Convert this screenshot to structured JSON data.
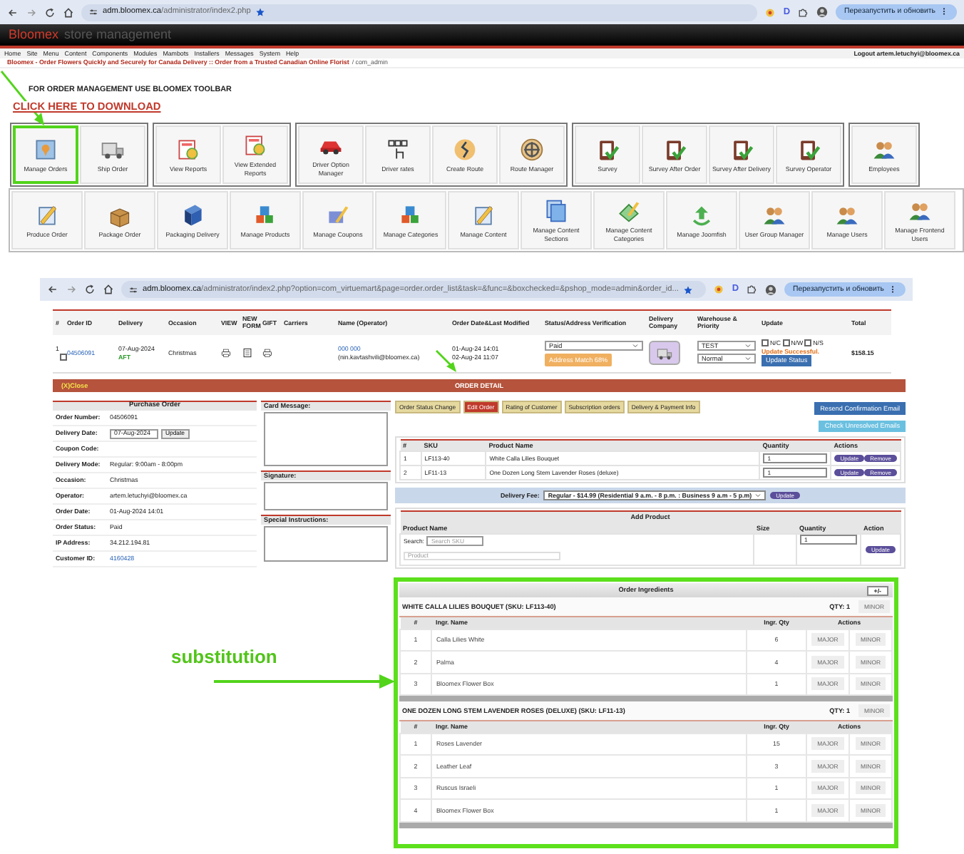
{
  "browsers": [
    {
      "host": "adm.bloomex.ca",
      "path": "/administrator/index2.php",
      "extension_letter": "D",
      "restart_button": "Перезапустить и обновить"
    },
    {
      "host": "adm.bloomex.ca",
      "path": "/administrator/index2.php?option=com_virtuemart&page=order.order_list&task=&func=&boxchecked=&pshop_mode=admin&order_id...",
      "extension_letter": "D",
      "restart_button": "Перезапустить и обновить"
    }
  ],
  "header": {
    "logo": "Bloomex",
    "subtitle": "store management"
  },
  "menu": [
    "Home",
    "Site",
    "Menu",
    "Content",
    "Components",
    "Modules",
    "Mambots",
    "Installers",
    "Messages",
    "System",
    "Help"
  ],
  "logout": "Logout artem.letuchyi@bloomex.ca",
  "breadcrumb": {
    "link": "Bloomex - Order Flowers Quickly and Securely for Canada Delivery :: Order from a Trusted Canadian Online Florist",
    "current": "/ com_admin"
  },
  "toolbar_notice": "FOR ORDER MANAGEMENT USE  BLOOMEX TOOLBAR",
  "download_link": "CLICK HERE TO DOWNLOAD",
  "toolbar_rows": [
    {
      "groups": [
        [
          {
            "label": "Manage Orders",
            "selected": true
          },
          {
            "label": "Ship Order",
            "selected": false
          }
        ],
        [
          {
            "label": "View Reports",
            "selected": false
          },
          {
            "label": "View Extended Reports",
            "selected": false
          }
        ],
        [
          {
            "label": "Driver Option Manager",
            "selected": false
          },
          {
            "label": "Driver rates",
            "selected": false
          },
          {
            "label": "Create Route",
            "selected": false
          },
          {
            "label": "Route Manager",
            "selected": false
          }
        ],
        [
          {
            "label": "Survey",
            "selected": false
          },
          {
            "label": "Survey After Order",
            "selected": false
          },
          {
            "label": "Survey After Delivery",
            "selected": false
          },
          {
            "label": "Survey Operator",
            "selected": false
          }
        ],
        [
          {
            "label": "Employees",
            "selected": false
          }
        ]
      ]
    },
    {
      "groups": [
        [
          {
            "label": "Produce Order",
            "selected": false
          },
          {
            "label": "Package Order",
            "selected": false
          },
          {
            "label": "Packaging Delivery",
            "selected": false
          },
          {
            "label": "Manage Products",
            "selected": false
          },
          {
            "label": "Manage Coupons",
            "selected": false
          },
          {
            "label": "Manage Categories",
            "selected": false
          },
          {
            "label": "Manage Content",
            "selected": false
          },
          {
            "label": "Manage Content Sections",
            "selected": false
          },
          {
            "label": "Manage Content Categories",
            "selected": false
          },
          {
            "label": "Manage Joomfish",
            "selected": false
          },
          {
            "label": "User Group Manager",
            "selected": false
          },
          {
            "label": "Manage Users",
            "selected": false
          },
          {
            "label": "Manage Frontend Users",
            "selected": false
          }
        ]
      ]
    }
  ],
  "order_table": {
    "columns": [
      "#",
      "Order ID",
      "Delivery",
      "Occasion",
      "VIEW",
      "NEW FORM",
      "GIFT",
      "Carriers",
      "Name (Operator)",
      "Order Date&Last Modified",
      "Status/Address Verification",
      "Delivery Company",
      "Warehouse & Priority",
      "Update",
      "Total"
    ],
    "rows": [
      {
        "number": "1",
        "checked": false,
        "order_id": "04506091",
        "delivery_date": "07-Aug-2024",
        "delivery_slot": "AFT",
        "occasion": "Christmas",
        "name": "000 000",
        "email": "(nin.kavtashvili@bloomex.ca)",
        "order_date": "01-Aug-24 14:01",
        "modified": "02-Aug-24 11:07",
        "status": "Paid",
        "address_match": "Address Match 68%",
        "warehouse": "TEST",
        "priority": "Normal",
        "flags": [
          {
            "label": "N/C",
            "checked": false
          },
          {
            "label": "N/W",
            "checked": false
          },
          {
            "label": "N/S",
            "checked": false
          }
        ],
        "update_message": "Update Successful.",
        "update_button": "Update Status",
        "total": "$158.15"
      }
    ]
  },
  "order_detail": {
    "close": "(X)Close",
    "title": "ORDER DETAIL"
  },
  "purchase_order": {
    "title": "Purchase Order",
    "fields": [
      {
        "label": "Order Number:",
        "value": "04506091",
        "kind": "text"
      },
      {
        "label": "Delivery Date:",
        "value": "07-Aug-2024",
        "button": "Update",
        "kind": "input"
      },
      {
        "label": "Coupon Code:",
        "kind": "text"
      },
      {
        "label": "Delivery Mode:",
        "value": "Regular: 9:00am - 8:00pm",
        "kind": "text"
      },
      {
        "label": "Occasion:",
        "value": "Christmas",
        "kind": "text"
      },
      {
        "label": "Operator:",
        "value": "artem.letuchyi@bloomex.ca",
        "kind": "text"
      },
      {
        "label": "Order Date:",
        "value": "01-Aug-2024 14:01",
        "kind": "text"
      },
      {
        "label": "Order Status:",
        "value": "Paid",
        "kind": "text"
      },
      {
        "label": "IP Address:",
        "value": "34.212.194.81",
        "kind": "text"
      },
      {
        "label": "Customer ID:",
        "value": "4160428",
        "kind": "link"
      }
    ]
  },
  "notes": [
    {
      "title": "Card Message:"
    },
    {
      "title": "Signature:"
    },
    {
      "title": "Special Instructions:"
    }
  ],
  "detail_tabs": [
    {
      "label": "Order Status Change",
      "selected": false
    },
    {
      "label": "Edit Order",
      "selected": true
    },
    {
      "label": "Rating of Customer",
      "selected": false
    },
    {
      "label": "Subscription orders",
      "selected": false
    },
    {
      "label": "Delivery & Payment Info",
      "selected": false
    }
  ],
  "email_buttons": [
    "Resend Confirmation Email",
    "Check Unresolved Emails"
  ],
  "products": {
    "columns": [
      "#",
      "SKU",
      "Product Name",
      "Quantity",
      "Actions"
    ],
    "rows": [
      {
        "number": "1",
        "sku": "LF113-40",
        "name": "White Calla Lilies Bouquet",
        "quantity": "1",
        "actions": [
          "Update",
          "Remove"
        ]
      },
      {
        "number": "2",
        "sku": "LF11-13",
        "name": "One Dozen Long Stem Lavender Roses (deluxe)",
        "quantity": "1",
        "actions": [
          "Update",
          "Remove"
        ]
      }
    ]
  },
  "delivery_fee": {
    "label": "Delivery Fee:",
    "value": "Regular - $14.99 (Residential 9 a.m. - 8 p.m. : Business 9 a.m - 5 p.m)",
    "button": "Update"
  },
  "add_product": {
    "title": "Add Product",
    "columns": [
      "Product Name",
      "Size",
      "Quantity",
      "Action"
    ],
    "search_label": "Search:",
    "search_placeholder": "Search SKU",
    "product_placeholder": "Product",
    "quantity": "1",
    "button": "Update"
  },
  "annotation": "substitution",
  "ingredients": {
    "title": "Order Ingredients",
    "toggle": "+/-",
    "products": [
      {
        "title": "WHITE CALLA LILIES BOUQUET (SKU: LF113-40)",
        "qty": "QTY: 1",
        "button": "MINOR",
        "columns": [
          "#",
          "Ingr. Name",
          "Ingr. Qty",
          "Actions"
        ],
        "rows": [
          {
            "number": "1",
            "name": "Calla Lilies White",
            "qty": "6",
            "actions": [
              "MAJOR",
              "MINOR"
            ]
          },
          {
            "number": "2",
            "name": "Palma",
            "qty": "4",
            "actions": [
              "MAJOR",
              "MINOR"
            ]
          },
          {
            "number": "3",
            "name": "Bloomex Flower Box",
            "qty": "1",
            "actions": [
              "MAJOR",
              "MINOR"
            ]
          }
        ]
      },
      {
        "title": "ONE DOZEN LONG STEM LAVENDER ROSES (DELUXE) (SKU: LF11-13)",
        "qty": "QTY: 1",
        "button": "MINOR",
        "columns": [
          "#",
          "Ingr. Name",
          "Ingr. Qty",
          "Actions"
        ],
        "rows": [
          {
            "number": "1",
            "name": "Roses Lavender",
            "qty": "15",
            "actions": [
              "MAJOR",
              "MINOR"
            ]
          },
          {
            "number": "2",
            "name": "Leather Leaf",
            "qty": "3",
            "actions": [
              "MAJOR",
              "MINOR"
            ]
          },
          {
            "number": "3",
            "name": "Ruscus Israeli",
            "qty": "1",
            "actions": [
              "MAJOR",
              "MINOR"
            ]
          },
          {
            "number": "4",
            "name": "Bloomex Flower Box",
            "qty": "1",
            "actions": [
              "MAJOR",
              "MINOR"
            ]
          }
        ]
      }
    ]
  }
}
